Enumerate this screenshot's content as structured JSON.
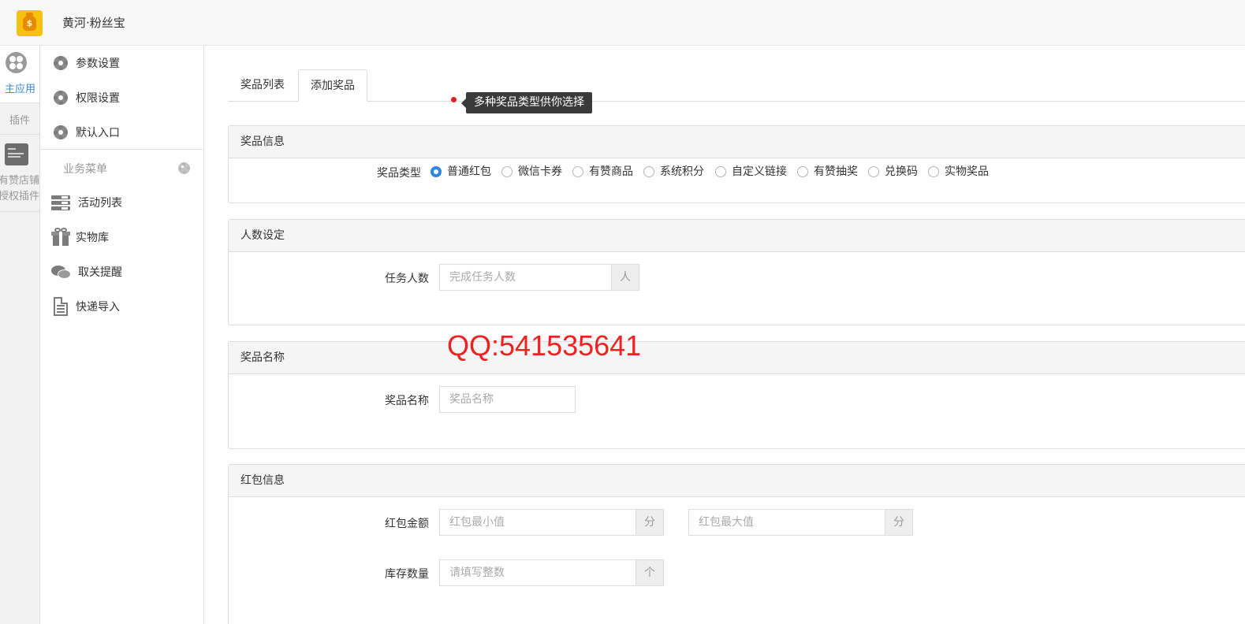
{
  "app": {
    "title": "黄河·粉丝宝",
    "logo_icon": "money-bag-icon",
    "accent": "#f7c20f"
  },
  "left_strip": {
    "main_label": "主应用",
    "plugin_label": "插件",
    "plugin_name_line1": "有赞店铺",
    "plugin_name_line2": "授权插件"
  },
  "sidebar": {
    "top_items": [
      {
        "label": "参数设置",
        "icon": "gear-icon"
      },
      {
        "label": "权限设置",
        "icon": "gear-icon"
      },
      {
        "label": "默认入口",
        "icon": "gear-icon"
      }
    ],
    "section_title": "业务菜单",
    "business_items": [
      {
        "label": "活动列表",
        "icon": "list-icon"
      },
      {
        "label": "实物库",
        "icon": "gift-icon"
      },
      {
        "label": "取关提醒",
        "icon": "chat-icon"
      },
      {
        "label": "快递导入",
        "icon": "document-icon"
      }
    ]
  },
  "tabs": [
    {
      "label": "奖品列表",
      "active": false
    },
    {
      "label": "添加奖品",
      "active": true
    }
  ],
  "tooltip": "多种奖品类型供你选择",
  "panels": {
    "prize_info": {
      "title": "奖品信息",
      "type_label": "奖品类型",
      "options": [
        "普通红包",
        "微信卡券",
        "有赞商品",
        "系统积分",
        "自定义链接",
        "有赞抽奖",
        "兑换码",
        "实物奖品"
      ],
      "selected": "普通红包"
    },
    "people": {
      "title": "人数设定",
      "label": "任务人数",
      "placeholder": "完成任务人数",
      "unit": "人"
    },
    "prize_name": {
      "title": "奖品名称",
      "label": "奖品名称",
      "placeholder": "奖品名称"
    },
    "red_packet": {
      "title": "红包信息",
      "amount_label": "红包金额",
      "min_placeholder": "红包最小值",
      "max_placeholder": "红包最大值",
      "amount_unit": "分",
      "stock_label": "库存数量",
      "stock_placeholder": "请填写整数",
      "stock_unit": "个"
    }
  },
  "watermark": "QQ:541535641"
}
